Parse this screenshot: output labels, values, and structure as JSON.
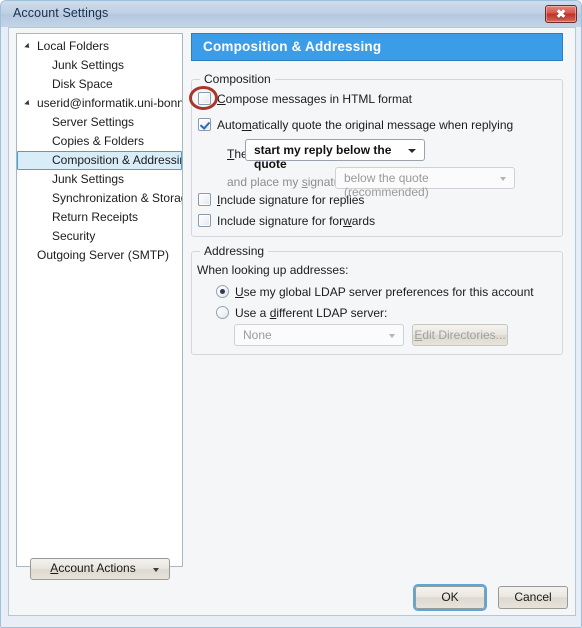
{
  "window": {
    "title": "Account Settings",
    "close_label": "✖"
  },
  "sidebar": {
    "items": [
      {
        "label": "Local Folders",
        "level": 0,
        "twisty": true,
        "selected": false
      },
      {
        "label": "Junk Settings",
        "level": 1,
        "twisty": false,
        "selected": false
      },
      {
        "label": "Disk Space",
        "level": 1,
        "twisty": false,
        "selected": false
      },
      {
        "label": "userid@informatik.uni-bonn...",
        "level": 0,
        "twisty": true,
        "selected": false
      },
      {
        "label": "Server Settings",
        "level": 1,
        "twisty": false,
        "selected": false
      },
      {
        "label": "Copies & Folders",
        "level": 1,
        "twisty": false,
        "selected": false
      },
      {
        "label": "Composition & Addressing",
        "level": 1,
        "twisty": false,
        "selected": true
      },
      {
        "label": "Junk Settings",
        "level": 1,
        "twisty": false,
        "selected": false
      },
      {
        "label": "Synchronization & Storage",
        "level": 1,
        "twisty": false,
        "selected": false
      },
      {
        "label": "Return Receipts",
        "level": 1,
        "twisty": false,
        "selected": false
      },
      {
        "label": "Security",
        "level": 1,
        "twisty": false,
        "selected": false
      },
      {
        "label": "Outgoing Server (SMTP)",
        "level": 0,
        "twisty": false,
        "selected": false
      }
    ],
    "account_actions_label": "Account Actions"
  },
  "panel": {
    "header": "Composition & Addressing",
    "composition": {
      "group_title": "Composition",
      "html_format": {
        "label": "Compose messages in HTML format",
        "checked": false,
        "highlighted": true
      },
      "auto_quote": {
        "label": "Automatically quote the original message when replying",
        "checked": true
      },
      "then_label": "Then,",
      "then_value": "start my reply below the quote",
      "signature_place_label": "and place my signature",
      "signature_place_value": "below the quote (recommended)",
      "signature_place_enabled": false,
      "sig_replies": {
        "label": "Include signature for replies",
        "checked": false
      },
      "sig_forwards": {
        "label": "Include signature for forwards",
        "checked": false
      }
    },
    "addressing": {
      "group_title": "Addressing",
      "lookup_label": "When looking up addresses:",
      "global_ldap": {
        "label": "Use my global LDAP server preferences for this account",
        "selected": true
      },
      "different_ldap": {
        "label": "Use a different LDAP server:",
        "selected": false
      },
      "server_value": "None",
      "server_enabled": false,
      "edit_directories_label": "Edit Directories...",
      "edit_directories_enabled": false
    }
  },
  "footer": {
    "ok_label": "OK",
    "cancel_label": "Cancel"
  },
  "colors": {
    "header_blue": "#3b9ce8",
    "selection_blue": "#d9edf9",
    "highlight_ring": "#a8372a",
    "close_red": "#bb3226",
    "focus_ring": "#5aa7e0"
  }
}
